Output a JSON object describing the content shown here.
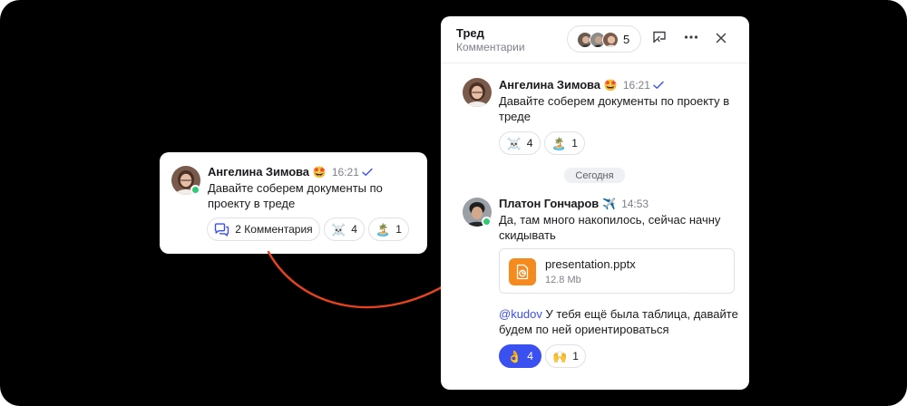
{
  "card": {
    "author": "Ангелина Зимова",
    "status_emoji": "🤩",
    "time": "16:21",
    "text_line1": "Давайте соберем документы по",
    "text_line2": "проекту в треде",
    "comments_label": "2 Комментария",
    "reactions": [
      {
        "emoji": "☠️",
        "count": "4"
      },
      {
        "emoji": "🏝️",
        "count": "1"
      }
    ]
  },
  "thread": {
    "title": "Тред",
    "subtitle": "Комментарии",
    "members_count": "5",
    "date_separator": "Сегодня",
    "messages": [
      {
        "author": "Ангелина Зимова",
        "status_emoji": "🤩",
        "time": "16:21",
        "text_line1": "Давайте соберем документы по проекту в",
        "text_line2": "треде",
        "reactions": [
          {
            "emoji": "☠️",
            "count": "4"
          },
          {
            "emoji": "🏝️",
            "count": "1"
          }
        ]
      },
      {
        "author": "Платон Гончаров",
        "status_emoji": "✈️",
        "time": "14:53",
        "text_line1": "Да, там много накопилось, сейчас начну",
        "text_line2": "скидывать",
        "file": {
          "name": "presentation.pptx",
          "size": "12.8 Mb"
        },
        "mention": "@kudov",
        "followup_line1_rest": " У тебя ещё была таблица, давайте",
        "followup_line2": "будем по ней ориентироваться",
        "reactions": [
          {
            "emoji": "👌",
            "count": "4",
            "active": true
          },
          {
            "emoji": "🙌",
            "count": "1"
          }
        ]
      }
    ]
  },
  "icons": {
    "check": "check-icon",
    "comments": "chat-bubbles-icon",
    "open_in_chat": "open-in-chat-icon",
    "more": "more-horizontal-icon",
    "close": "close-icon",
    "file": "presentation-file-icon"
  },
  "colors": {
    "background": "#000000",
    "accent": "#3b50f0",
    "online": "#2fca73",
    "arrow": "#e8431f",
    "file_icon": "#f58a1f"
  }
}
